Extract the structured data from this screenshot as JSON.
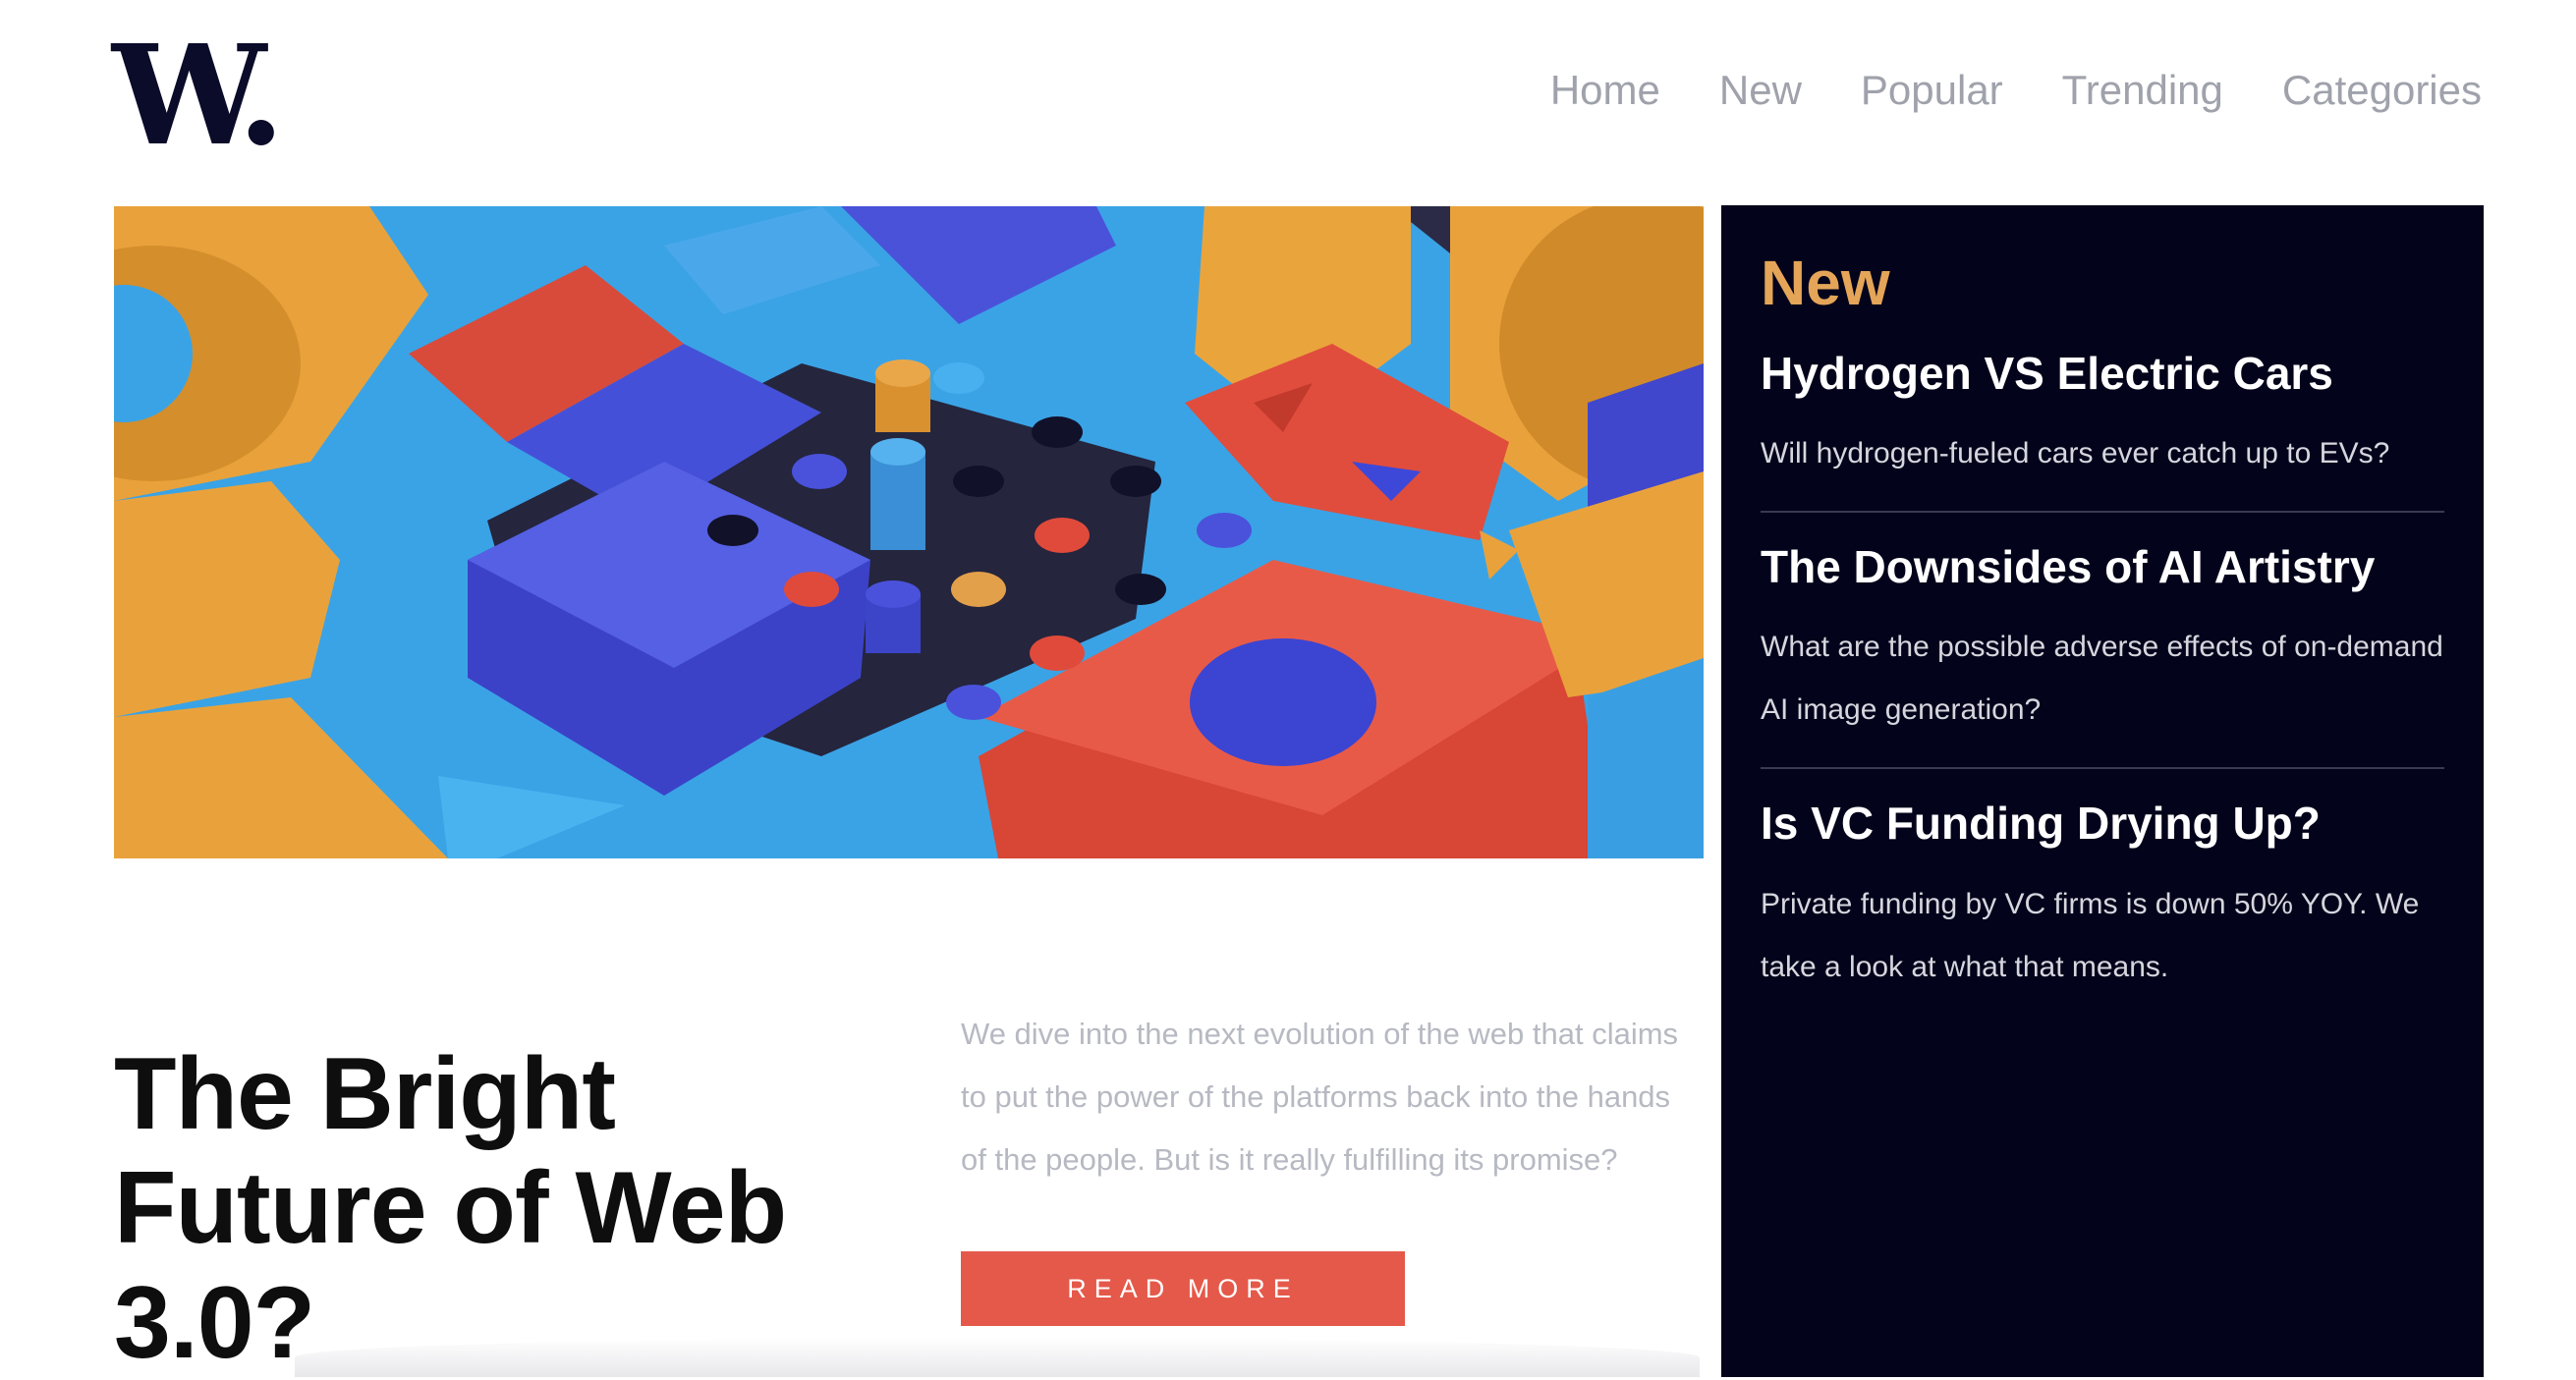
{
  "logo": {
    "text": "W."
  },
  "nav": {
    "items": [
      "Home",
      "New",
      "Popular",
      "Trending",
      "Categories"
    ]
  },
  "hero": {
    "image_alt": "3D abstract colorful blocks illustration"
  },
  "featured": {
    "title": "The Bright Future of Web 3.0?",
    "excerpt": "We dive into the next evolution of the web that claims to put the power of the platforms back into the hands of the people. But is it really fulfilling its promise?",
    "read_more": "READ MORE"
  },
  "sidebar": {
    "title": "New",
    "articles": [
      {
        "title": "Hydrogen VS Electric Cars",
        "desc": "Will hydrogen-fueled cars ever catch up to EVs?"
      },
      {
        "title": "The Downsides of AI Artistry",
        "desc": "What are the possible adverse effects of on-demand AI image generation?"
      },
      {
        "title": "Is VC Funding Drying Up?",
        "desc": "Private funding by VC firms is down 50% YOY. We take a look at what that means."
      }
    ]
  },
  "colors": {
    "accent": "#e5594a",
    "sidebar_bg": "#03031b",
    "sidebar_heading": "#e4a558",
    "nav_text": "#9fa2ab"
  }
}
